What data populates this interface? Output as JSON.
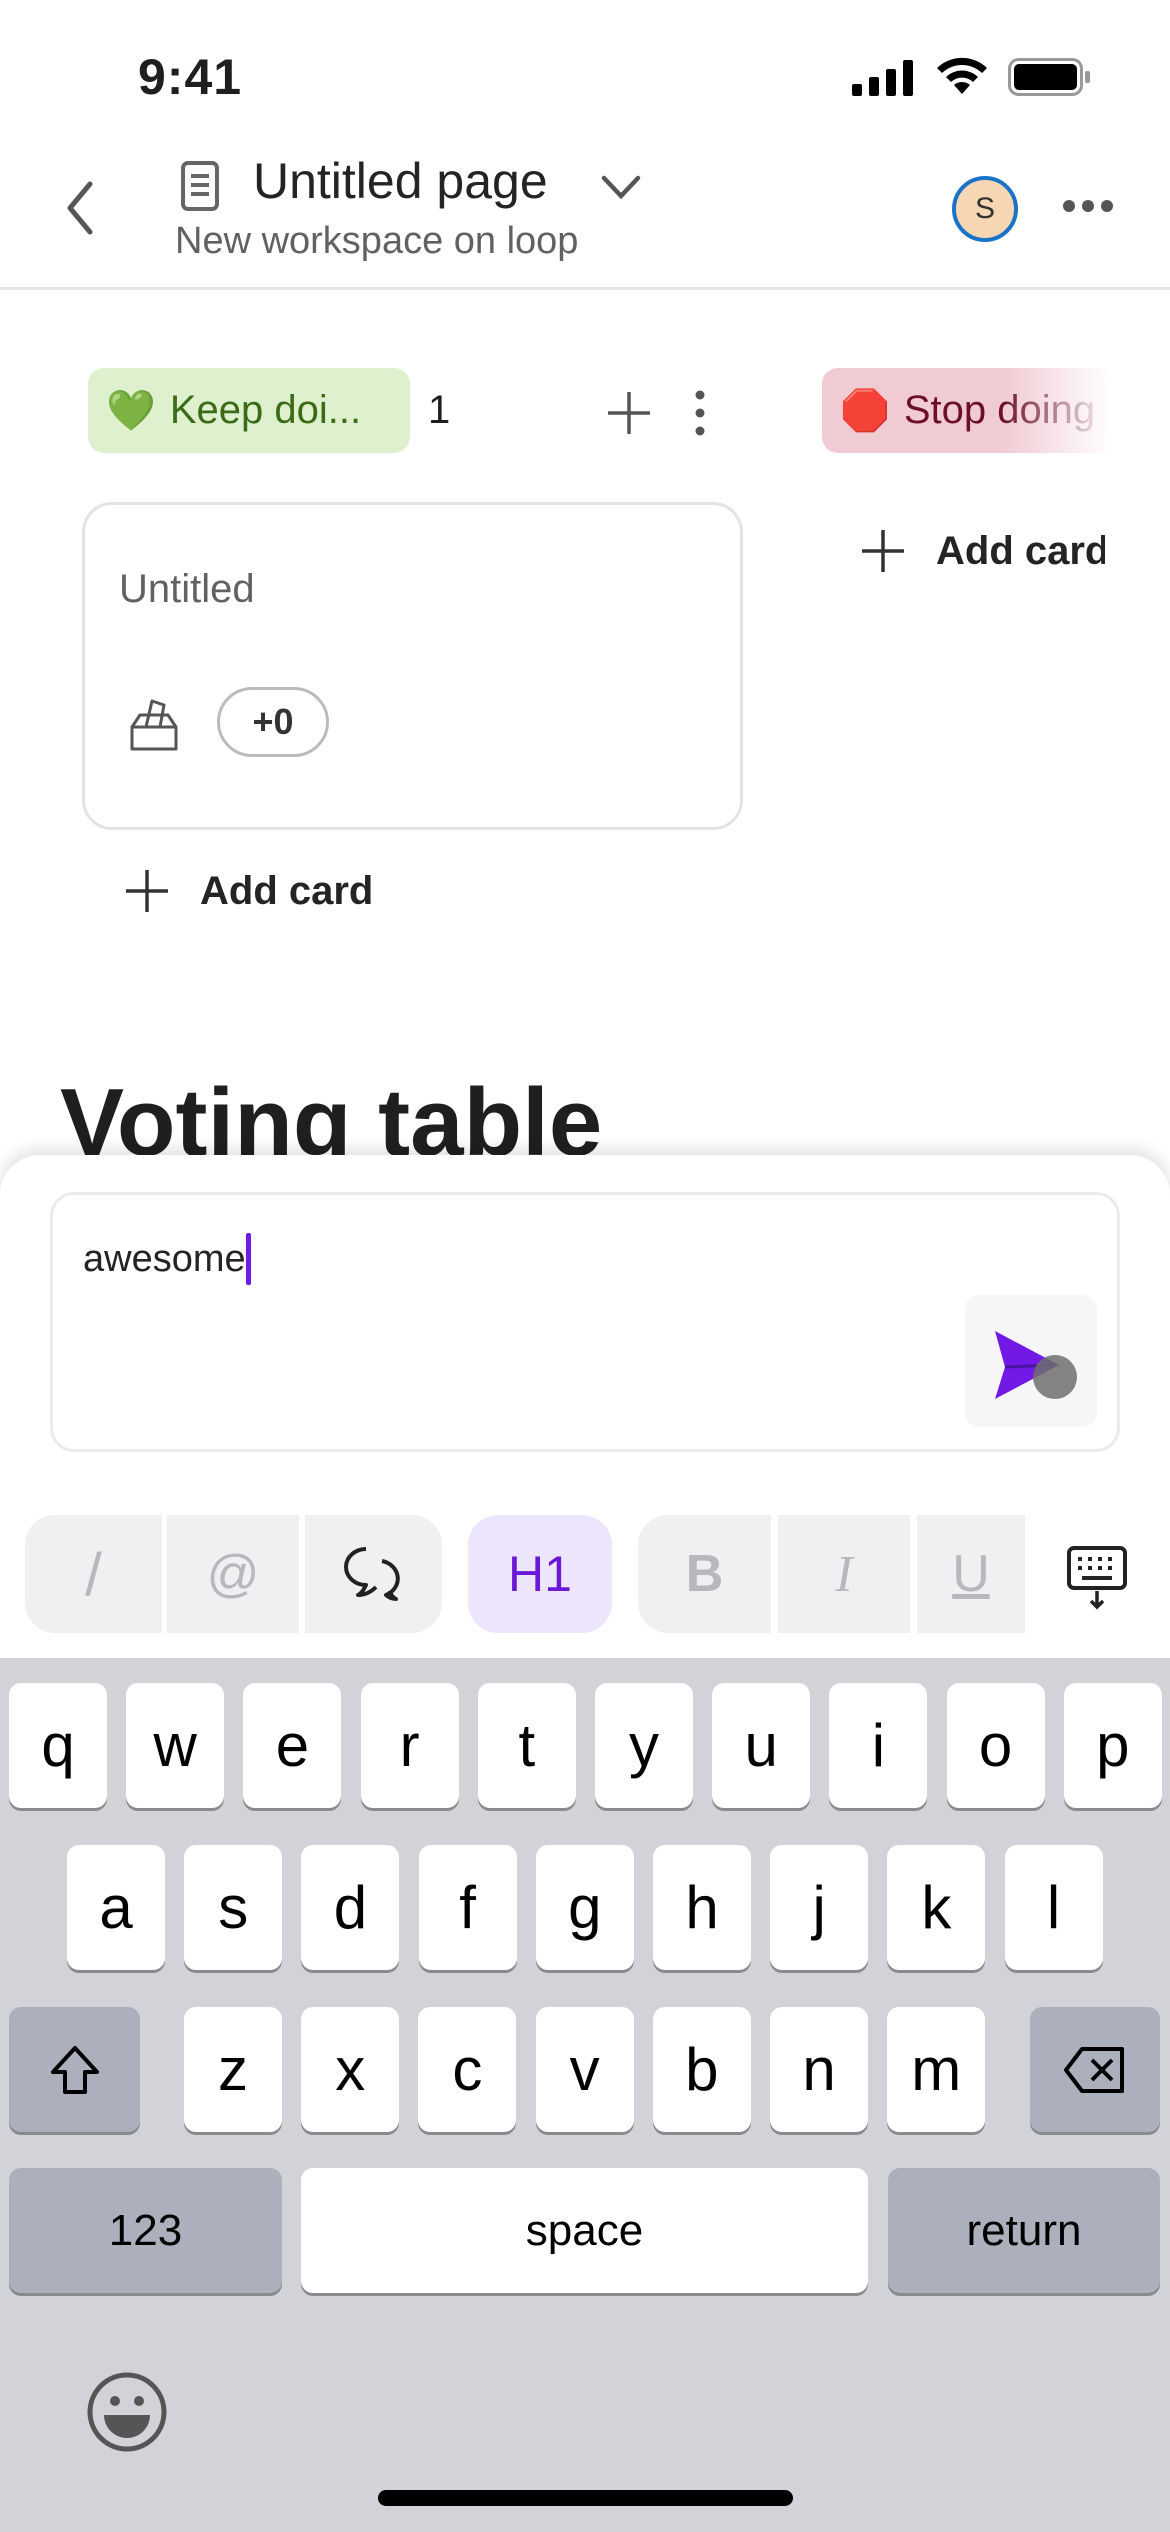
{
  "status_bar": {
    "time": "9:41"
  },
  "header": {
    "title": "Untitled page",
    "subtitle": "New workspace on loop",
    "avatar_initial": "S",
    "back_icon": "chevron-left-icon",
    "page_icon": "document-icon",
    "menu_icon": "more-horizontal-icon"
  },
  "board": {
    "columns": [
      {
        "label": "Keep doi...",
        "emoji": "💚",
        "count": "1",
        "color": "#dff0cf",
        "cards": [
          {
            "title": "Untitled",
            "votes": "+0"
          }
        ],
        "add_label": "Add card"
      },
      {
        "label": "Stop doing",
        "emoji": "🛑",
        "color": "#f0cbd3",
        "add_label": "Add card"
      }
    ]
  },
  "section_heading": "Voting table",
  "composer": {
    "value": "awesome",
    "accent": "#7219e6",
    "send_icon": "send-icon"
  },
  "toolbar": {
    "slash": "/",
    "mention": "@",
    "comment_icon": "comment-icon",
    "h1": "H1",
    "bold": "B",
    "italic": "I",
    "underline": "U",
    "keyboard_icon": "keyboard-dismiss-icon"
  },
  "keyboard": {
    "rows": [
      [
        "q",
        "w",
        "e",
        "r",
        "t",
        "y",
        "u",
        "i",
        "o",
        "p"
      ],
      [
        "a",
        "s",
        "d",
        "f",
        "g",
        "h",
        "j",
        "k",
        "l"
      ],
      [
        "z",
        "x",
        "c",
        "v",
        "b",
        "n",
        "m"
      ]
    ],
    "numbers": "123",
    "space": "space",
    "return": "return"
  }
}
